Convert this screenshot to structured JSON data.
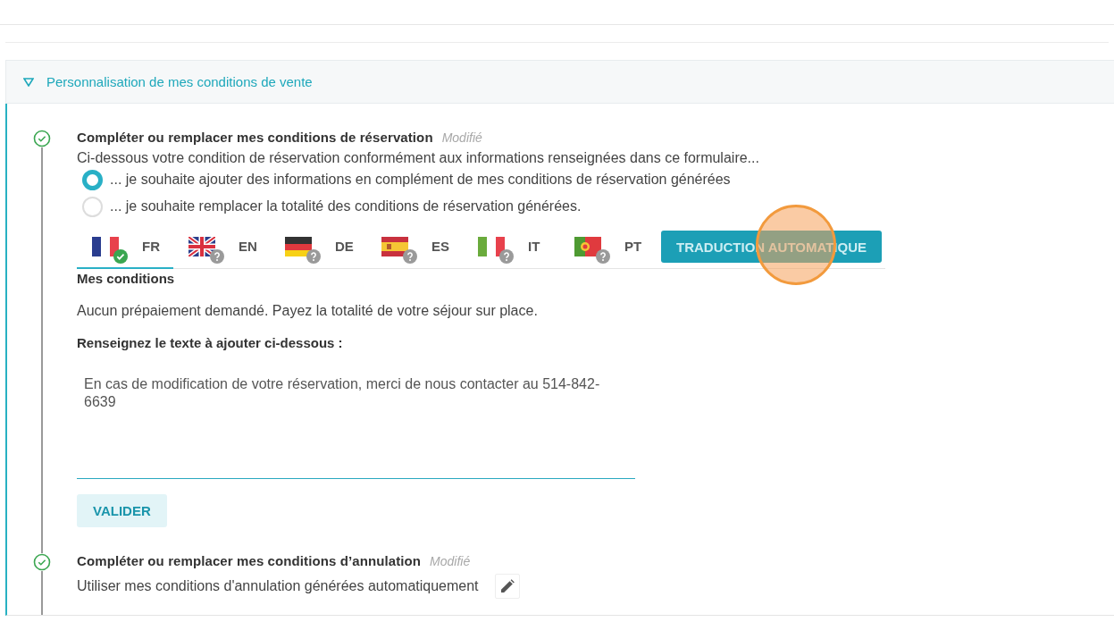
{
  "section": {
    "title": "Personnalisation de mes conditions de vente",
    "expanded": true
  },
  "steps": [
    {
      "kind": "form",
      "done": true,
      "title": "Compléter ou remplacer mes conditions de réservation",
      "status": "Modifié",
      "description": "Ci-dessous votre condition de réservation conformément aux informations renseignées dans ce formulaire...",
      "options": [
        {
          "label": "... je souhaite ajouter des informations en complément de mes conditions de réservation générées",
          "selected": true
        },
        {
          "label": "... je souhaite remplacer la totalité des conditions de réservation générées.",
          "selected": false
        }
      ],
      "languages": [
        {
          "kind": "fr",
          "code": "FR",
          "translated": true,
          "selected": true
        },
        {
          "kind": "gb",
          "code": "EN",
          "translated": false,
          "selected": false
        },
        {
          "kind": "de",
          "code": "DE",
          "translated": false,
          "selected": false
        },
        {
          "kind": "es",
          "code": "ES",
          "translated": false,
          "selected": false
        },
        {
          "kind": "it",
          "code": "IT",
          "translated": false,
          "selected": false
        },
        {
          "kind": "pt",
          "code": "PT",
          "translated": false,
          "selected": false
        }
      ],
      "translate_button": "TRADUCTION AUTOMATIQUE",
      "current_heading": "Mes conditions",
      "current_text": "Aucun prépaiement demandé. Payez la totalité de votre séjour sur place.",
      "input_label": "Renseignez le texte à ajouter ci-dessous :",
      "input_value": "En cas de modification de votre réservation, merci de nous contacter au 514-842-6639",
      "submit_button": "VALIDER"
    },
    {
      "kind": "summary",
      "done": true,
      "title": "Compléter ou remplacer mes conditions d’annulation",
      "status": "Modifié",
      "description": "Utiliser mes conditions d'annulation générées automatiquement"
    }
  ]
}
